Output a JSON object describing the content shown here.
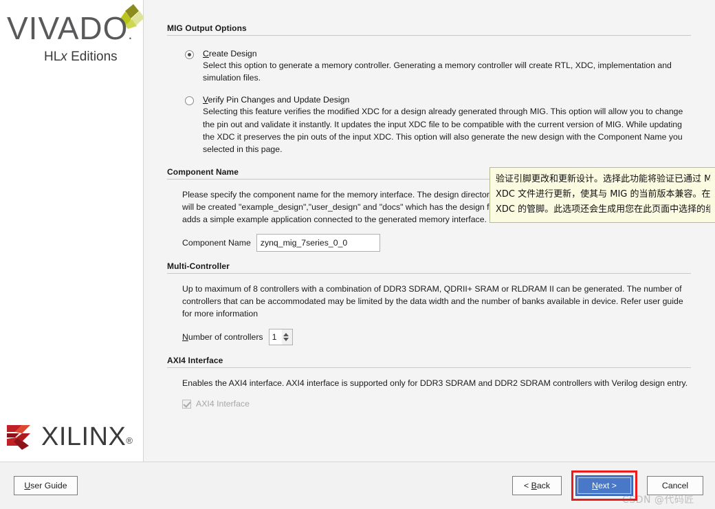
{
  "branding": {
    "vivado_name": "VIVADO",
    "vivado_dot": ".",
    "vivado_edition_prefix": "HL",
    "vivado_edition_italic": "x",
    "vivado_edition_suffix": " Editions",
    "xilinx_name": "XILINX",
    "xilinx_registered": "®"
  },
  "sections": {
    "mig_output": {
      "title": "MIG Output Options",
      "options": [
        {
          "mnemonic": "C",
          "label_rest": "reate Design",
          "selected": true,
          "description": "Select this option to generate a memory controller. Generating a memory controller will create RTL, XDC, implementation and simulation files."
        },
        {
          "mnemonic": "V",
          "label_rest": "erify Pin Changes and Update Design",
          "selected": false,
          "description": "Selecting this feature verifies the modified XDC for a design already generated through MIG. This option will allow you to change the pin out and validate it instantly. It updates the input XDC file to be compatible with the current version of MIG. While updating the XDC it preserves the pin outs of the input XDC. This option will also generate the new design with the Component Name you selected in this page."
        }
      ]
    },
    "component_name": {
      "title": "Component Name",
      "description": "Please specify the component name for the memory interface. The design directories will be created using this name. Three directories will be created \"example_design\",\"user_design\" and \"docs\" which has the design files for the memory interface. The example_design adds a simple example application connected to the generated memory interface.",
      "field_label": "Component Name",
      "field_value": "zynq_mig_7series_0_0"
    },
    "multi_controller": {
      "title": "Multi-Controller",
      "description": "Up to maximum of 8 controllers with a combination of DDR3 SDRAM, QDRII+ SRAM or RLDRAM II can be generated. The number of controllers that can be accommodated may be limited by the data width and the number of banks available in device. Refer user guide for more information",
      "field_label_mnemonic": "N",
      "field_label_rest": "umber of controllers",
      "field_value": "1"
    },
    "axi4": {
      "title": "AXI4 Interface",
      "description": "Enables the AXI4 interface. AXI4 interface is supported only for DDR3 SDRAM and DDR2 SDRAM controllers with Verilog design entry.",
      "checkbox_label": "AXI4 Interface",
      "checked": true,
      "disabled": true
    }
  },
  "tooltip": {
    "line1": "验证引脚更改和更新设计。选择此功能将验证已通过 MIG 生成",
    "line2": "XDC 文件进行更新，使其与 MIG 的当前版本兼容。在更新 XD",
    "line3": "XDC 的管脚。此选项还会生成用您在此页面中选择的组件名称"
  },
  "footer": {
    "user_guide_mnemonic": "U",
    "user_guide_rest": "ser Guide",
    "back_prefix": "< ",
    "back_mnemonic": "B",
    "back_rest": "ack",
    "next_mnemonic": "N",
    "next_rest": "ext >",
    "cancel_label": "Cancel"
  },
  "watermark": "CSDN @代码匠",
  "colors": {
    "accent_blue": "#4a78c8",
    "highlight_red": "#e81c1c",
    "tooltip_bg": "#fbfbe2",
    "xilinx_red": "#c02026",
    "vivado_green": "#c8d420"
  }
}
